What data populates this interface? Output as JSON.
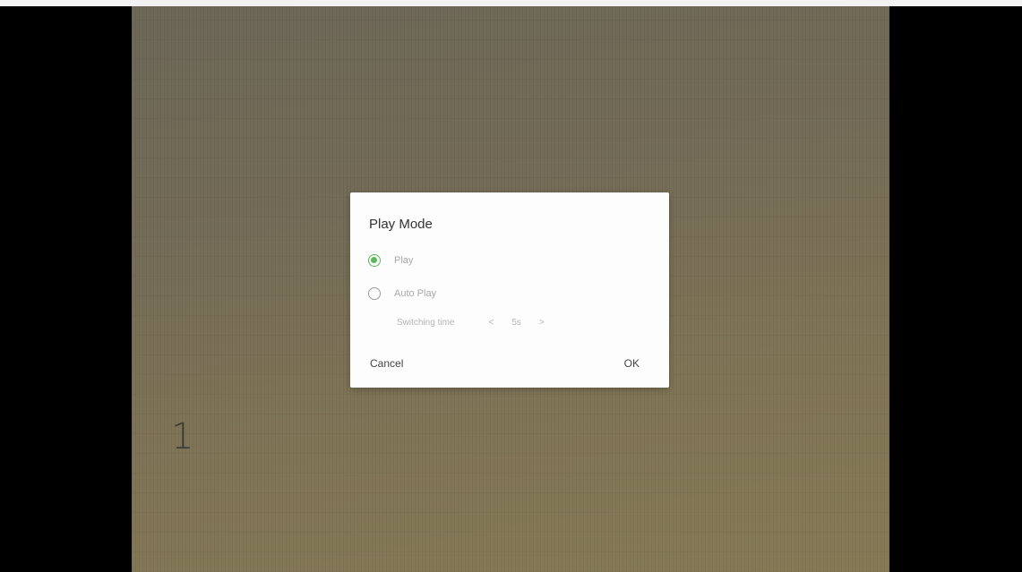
{
  "page": {
    "page_number": "1"
  },
  "dialog": {
    "title": "Play Mode",
    "options": [
      {
        "label": "Play",
        "checked": true
      },
      {
        "label": "Auto Play",
        "checked": false
      }
    ],
    "switching_time": {
      "label": "Switching time",
      "decrement": "<",
      "value": "5s",
      "increment": ">"
    },
    "cancel_label": "Cancel",
    "ok_label": "OK"
  },
  "colors": {
    "accent": "#5cb85c",
    "dialog_bg": "#fdfdfd"
  }
}
